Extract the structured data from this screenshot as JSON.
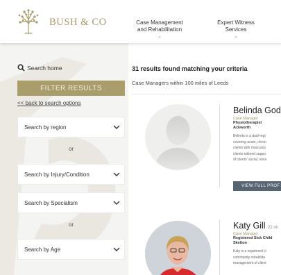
{
  "header": {
    "brand": "BUSH & CO",
    "nav": [
      {
        "line1": "Case Management",
        "line2": "and Rehabilitation"
      },
      {
        "line1": "Expert Witness",
        "line2": "Services"
      }
    ]
  },
  "sidebar": {
    "search_home": "Search home",
    "filter_button": "FILTER RESULTS",
    "back_link": "<< back to search options",
    "selects": [
      "Search by region",
      "Search by Injury/Condition",
      "Search by Specialism",
      "Search by Age"
    ],
    "or_label": "or"
  },
  "results": {
    "count_text": "31 results found matching your criteria",
    "subtitle": "Case Managers within 100 miles of Leeds",
    "cards": [
      {
        "name": "Belinda God",
        "distance": "",
        "role": "Case Manager",
        "specialism": "Physiotherapist",
        "location": "Ackworth",
        "bio": [
          "Belinda is a dual-regi",
          "covering acute, chron",
          "clients with musculos",
          "clients tailored suppo",
          "of clients' social, voca"
        ],
        "button": "VIEW FULL PROF"
      },
      {
        "name": "Katy Gill",
        "distance": "22 mi",
        "role": "Case Manager",
        "specialism": "Registered Sick Child",
        "location": "Skelton",
        "bio": [
          "Katy is a registered cl",
          "community rehabilita",
          "management of client"
        ],
        "button": ""
      }
    ]
  },
  "colors": {
    "accent": "#a99d6c",
    "button_dark": "#566472",
    "background": "#f4f4f2"
  }
}
